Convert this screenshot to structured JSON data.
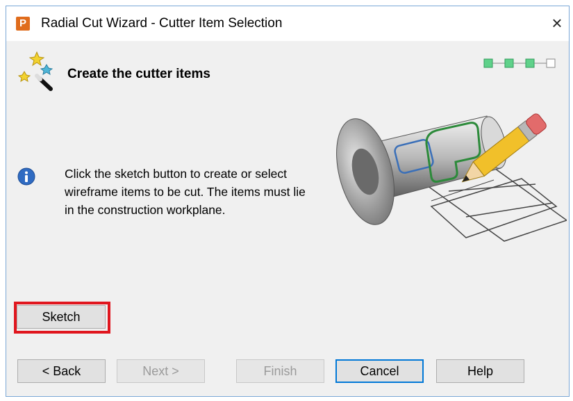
{
  "window": {
    "app_icon_letter": "P",
    "title": "Radial Cut Wizard - Cutter Item Selection",
    "close_glyph": "×"
  },
  "header": {
    "heading": "Create the cutter items",
    "wizard_icon": "magic-wand-icon",
    "progress_steps_total": 4,
    "progress_steps_completed": 3
  },
  "content": {
    "info_icon": "info-icon",
    "message": "Click the sketch button to create or select wireframe items to be cut. The items must lie in the construction workplane.",
    "illustration": "cylinder-sketch-pencil-illustration"
  },
  "buttons": {
    "sketch": "Sketch",
    "back": "< Back",
    "next": "Next >",
    "finish": "Finish",
    "cancel": "Cancel",
    "help": "Help"
  },
  "colors": {
    "highlight": "#e0161e",
    "default_button_border": "#0078d7",
    "progress_done": "#5fd18a",
    "app_icon": "#e06c1c"
  }
}
